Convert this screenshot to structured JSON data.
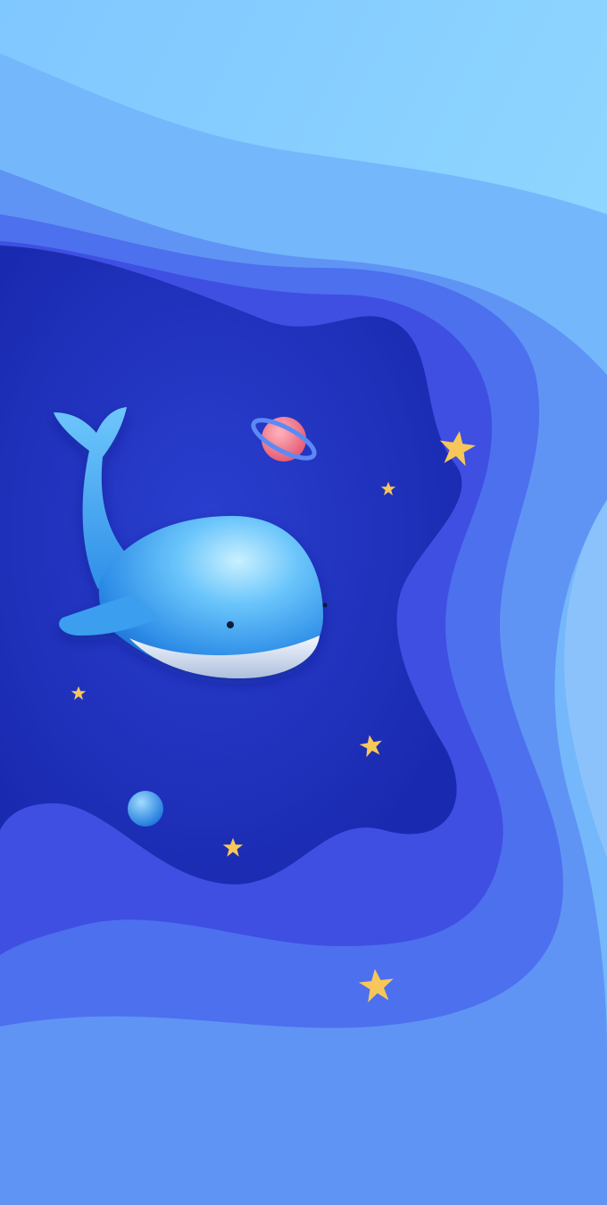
{
  "scene": {
    "subject": "whale",
    "palette": {
      "sky_light": "#8fd6ff",
      "layer_2": "#74b8fb",
      "layer_3": "#5f94f5",
      "layer_4": "#4d70ee",
      "layer_5": "#3e4fe2",
      "deep_space": "#2233c4",
      "whale_body": "#3aa6f0",
      "whale_belly": "#dfe7f5",
      "planet": "#f07a8f",
      "planet_ring": "#5b8af5",
      "star": "#f7c75a",
      "orb": "#3f9cf0"
    },
    "icons": [
      "whale-illustration",
      "ringed-planet-icon",
      "star-icon",
      "blue-orb-icon"
    ]
  }
}
